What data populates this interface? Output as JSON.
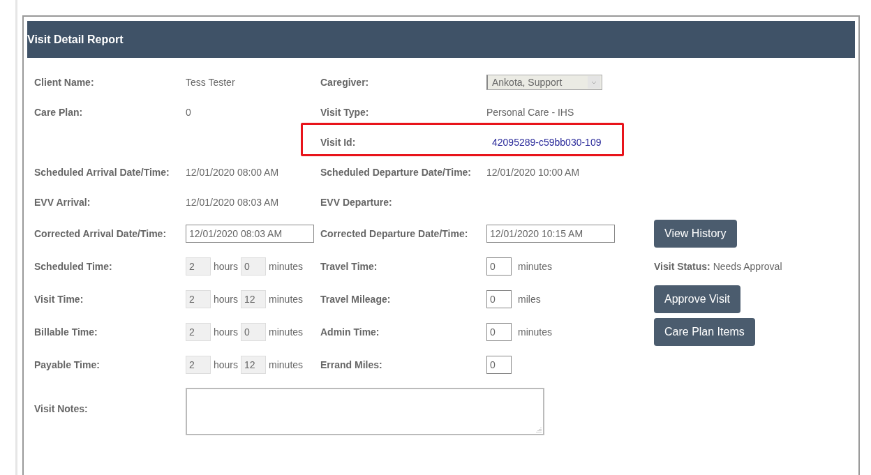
{
  "panel": {
    "title": "Visit Detail Report"
  },
  "rows": [
    {
      "left": {
        "label": "Client Name:",
        "value": {
          "kind": "text",
          "text": "Tess Tester"
        }
      },
      "right": {
        "label": "Caregiver:",
        "value": {
          "kind": "select",
          "text": "Ankota, Support",
          "disabled": true
        }
      }
    },
    {
      "left": {
        "label": "Care Plan:",
        "value": {
          "kind": "text",
          "text": "0"
        }
      },
      "right": {
        "label": "Visit Type:",
        "value": {
          "kind": "text",
          "text": "Personal Care - IHS"
        }
      }
    },
    {
      "right": {
        "label": "Visit Id:",
        "value": {
          "kind": "link",
          "text": "42095289-c59bb030-109"
        },
        "highlighted": true
      }
    },
    {
      "left": {
        "label": "Scheduled Arrival Date/Time:",
        "value": {
          "kind": "text",
          "text": "12/01/2020 08:00 AM"
        }
      },
      "right": {
        "label": "Scheduled Departure Date/Time:",
        "value": {
          "kind": "text",
          "text": "12/01/2020 10:00 AM"
        }
      }
    },
    {
      "left": {
        "label": "EVV Arrival:",
        "value": {
          "kind": "text",
          "text": "12/01/2020 08:03 AM"
        }
      },
      "right": {
        "label": "EVV Departure:"
      }
    },
    {
      "left": {
        "label": "Corrected Arrival Date/Time:",
        "value": {
          "kind": "input",
          "text": "12/01/2020 08:03 AM"
        }
      },
      "right": {
        "label": "Corrected Departure Date/Time:",
        "value": {
          "kind": "input",
          "text": "12/01/2020 10:15 AM"
        }
      },
      "side": {
        "kind": "button",
        "text": "View History"
      }
    },
    {
      "left": {
        "label": "Scheduled Time:",
        "value": {
          "kind": "duration",
          "hours": "2",
          "hours_unit": "hours",
          "minutes": "0",
          "minutes_unit": "minutes",
          "disabled": true
        }
      },
      "right": {
        "label": "Travel Time:",
        "value": {
          "kind": "count",
          "text": "0",
          "unit": "minutes"
        }
      },
      "side": {
        "kind": "status",
        "label": "Visit Status:",
        "text": "Needs Approval"
      }
    },
    {
      "left": {
        "label": "Visit Time:",
        "value": {
          "kind": "duration",
          "hours": "2",
          "hours_unit": "hours",
          "minutes": "12",
          "minutes_unit": "minutes",
          "disabled": true
        }
      },
      "right": {
        "label": "Travel Mileage:",
        "value": {
          "kind": "count",
          "text": "0",
          "unit": "miles"
        }
      },
      "side": {
        "kind": "button",
        "text": "Approve Visit"
      }
    },
    {
      "left": {
        "label": "Billable Time:",
        "value": {
          "kind": "duration",
          "hours": "2",
          "hours_unit": "hours",
          "minutes": "0",
          "minutes_unit": "minutes",
          "disabled": true
        }
      },
      "right": {
        "label": "Admin Time:",
        "value": {
          "kind": "count",
          "text": "0",
          "unit": "minutes"
        }
      },
      "side": {
        "kind": "button",
        "text": "Care Plan Items"
      }
    },
    {
      "left": {
        "label": "Payable Time:",
        "value": {
          "kind": "duration",
          "hours": "2",
          "hours_unit": "hours",
          "minutes": "12",
          "minutes_unit": "minutes",
          "disabled": true
        }
      },
      "right": {
        "label": "Errand Miles:",
        "value": {
          "kind": "count",
          "text": "0"
        }
      }
    },
    {
      "left": {
        "label": "Visit Notes:",
        "value": {
          "kind": "textarea"
        }
      }
    }
  ]
}
